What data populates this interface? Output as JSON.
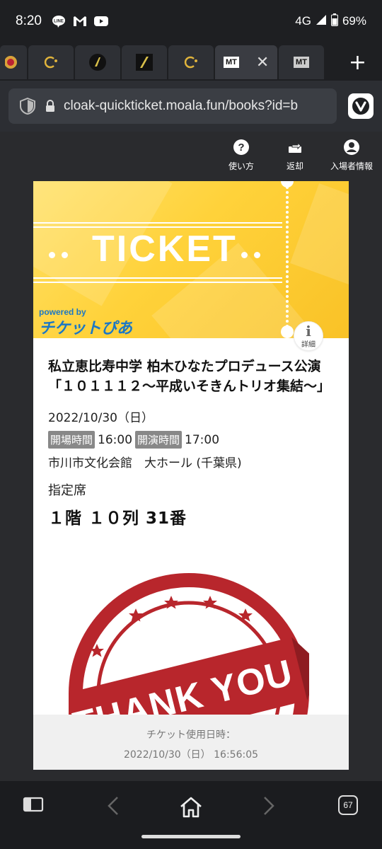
{
  "status_bar": {
    "time": "8:20",
    "network": "4G",
    "battery": "69%",
    "notification_icons": [
      "line-icon",
      "gmail-icon",
      "youtube-icon"
    ]
  },
  "tabs": {
    "active_tab_label": "MT",
    "other_tab_label": "MT",
    "new_tab_symbol": "+",
    "close_symbol": "✕"
  },
  "address_bar": {
    "url": "cloak-quickticket.moala.fun/books?id=b"
  },
  "page_toolbar": {
    "help_label": "使い方",
    "return_label": "返却",
    "entrant_label": "入場者情報"
  },
  "ticket": {
    "header_word": "TICKET",
    "powered_by": "powered by",
    "brand": "チケットぴあ",
    "info_label": "詳細",
    "title": "私立恵比寿中学 柏木ひなたプロデュース公演「１０１１１２〜平成いそきんトリオ集結〜」",
    "date": "2022/10/30（日）",
    "open_label": "開場時間",
    "open_time": "16:00",
    "start_label": "開演時間",
    "start_time": "17:00",
    "venue": "市川市文化会館　大ホール (千葉県)",
    "seat_type": "指定席",
    "seat": "１階 １０列 31番",
    "stamp_text": "THANK YOU",
    "used_label": "チケット使用日時：",
    "used_datetime": "2022/10/30（日） 16:56:05"
  },
  "bottom_nav": {
    "tab_count": "67"
  },
  "colors": {
    "ticket_yellow": "#ffd23a",
    "brand_blue": "#1b77c5",
    "stamp_red": "#b8262c",
    "badge_gray": "#888888"
  }
}
